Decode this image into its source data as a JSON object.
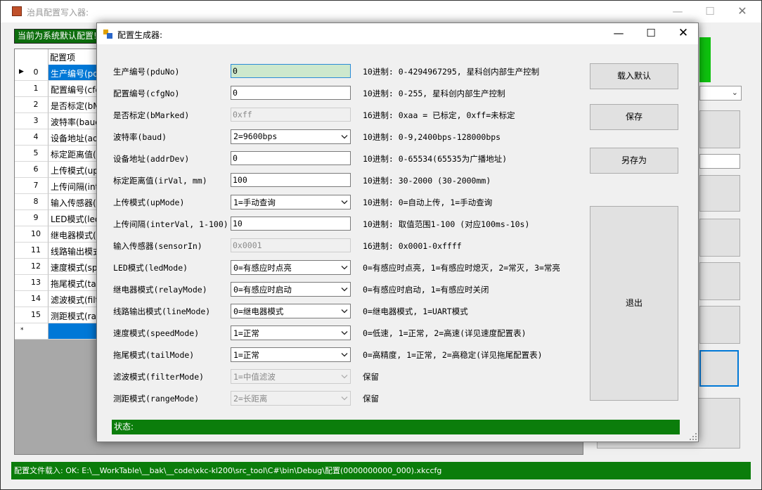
{
  "main_window": {
    "title": "治具配置写入器:",
    "caption": {
      "minimize": "—",
      "maximize": "☐",
      "close": "✕"
    },
    "default_banner": "当前为系统默认配置!",
    "grid": {
      "column_header": "配置项",
      "rows": [
        {
          "index": "0",
          "text": "生产编号(pduNo)",
          "selected": true
        },
        {
          "index": "1",
          "text": "配置编号(cfgNo)"
        },
        {
          "index": "2",
          "text": "是否标定(bMarked)"
        },
        {
          "index": "3",
          "text": "波特率(baud)"
        },
        {
          "index": "4",
          "text": "设备地址(addrDev)"
        },
        {
          "index": "5",
          "text": "标定距离值(irVal, mm)"
        },
        {
          "index": "6",
          "text": "上传模式(upMode)"
        },
        {
          "index": "7",
          "text": "上传间隔(interVal, 1-100)"
        },
        {
          "index": "8",
          "text": "输入传感器(sensorIn)"
        },
        {
          "index": "9",
          "text": "LED模式(ledMode)"
        },
        {
          "index": "10",
          "text": "继电器模式(relayMode)"
        },
        {
          "index": "11",
          "text": "线路输出模式(lineMode)"
        },
        {
          "index": "12",
          "text": "速度模式(speedMode)"
        },
        {
          "index": "13",
          "text": "拖尾模式(tailMode)"
        },
        {
          "index": "14",
          "text": "滤波模式(filterMode)"
        },
        {
          "index": "15",
          "text": "测距模式(rangeMode)"
        }
      ],
      "current_row_marker": "▶",
      "new_row_marker": "*"
    },
    "status_bar": "配置文件载入: OK: E:\\__WorkTable\\__bak\\__code\\xkc-kl200\\src_tool\\C#\\bin\\Debug\\配置(0000000000_000).xkccfg"
  },
  "dialog": {
    "title": "配置生成器:",
    "caption": {
      "minimize": "—",
      "maximize": "☐",
      "close": "✕"
    },
    "fields": [
      {
        "label": "生产编号(pduNo)",
        "control": "input",
        "value": "0",
        "state": "focused",
        "note": "10进制: 0-4294967295, 星科创内部生产控制"
      },
      {
        "label": "配置编号(cfgNo)",
        "control": "input",
        "value": "0",
        "state": "normal",
        "note": "10进制: 0-255, 星科创内部生产控制"
      },
      {
        "label": "是否标定(bMarked)",
        "control": "input",
        "value": "0xff",
        "state": "disabled",
        "note": "16进制: 0xaa = 已标定, 0xff=未标定"
      },
      {
        "label": "波特率(baud)",
        "control": "select",
        "value": "2=9600bps",
        "state": "normal",
        "note": "10进制: 0-9,2400bps-128000bps"
      },
      {
        "label": "设备地址(addrDev)",
        "control": "input",
        "value": "0",
        "state": "normal",
        "note": "10进制: 0-65534(65535为广播地址)"
      },
      {
        "label": "标定距离值(irVal, mm)",
        "control": "input",
        "value": "100",
        "state": "normal",
        "note": "10进制: 30-2000 (30-2000mm)"
      },
      {
        "label": "上传模式(upMode)",
        "control": "select",
        "value": "1=手动查询",
        "state": "normal",
        "note": "10进制: 0=自动上传, 1=手动查询"
      },
      {
        "label": "上传间隔(interVal, 1-100)",
        "control": "input",
        "value": "10",
        "state": "normal",
        "note": "10进制: 取值范围1-100 (对应100ms-10s)"
      },
      {
        "label": "输入传感器(sensorIn)",
        "control": "input",
        "value": "0x0001",
        "state": "disabled",
        "note": "16进制: 0x0001-0xffff"
      },
      {
        "label": "LED模式(ledMode)",
        "control": "select",
        "value": "0=有感应时点亮",
        "state": "normal",
        "note": "0=有感应时点亮, 1=有感应时熄灭, 2=常灭, 3=常亮"
      },
      {
        "label": "继电器模式(relayMode)",
        "control": "select",
        "value": "0=有感应时启动",
        "state": "normal",
        "note": "0=有感应时启动, 1=有感应时关闭"
      },
      {
        "label": "线路输出模式(lineMode)",
        "control": "select",
        "value": "0=继电器模式",
        "state": "normal",
        "note": "0=继电器模式, 1=UART模式"
      },
      {
        "label": "速度模式(speedMode)",
        "control": "select",
        "value": "1=正常",
        "state": "normal",
        "note": "0=低速, 1=正常, 2=高速(详见速度配置表)"
      },
      {
        "label": "拖尾模式(tailMode)",
        "control": "select",
        "value": "1=正常",
        "state": "normal",
        "note": "0=高精度, 1=正常, 2=高稳定(详见拖尾配置表)"
      },
      {
        "label": "滤波模式(filterMode)",
        "control": "select",
        "value": "1=中值滤波",
        "state": "disabled",
        "note": "保留"
      },
      {
        "label": "测距模式(rangeMode)",
        "control": "select",
        "value": "2=长距离",
        "state": "disabled",
        "note": "保留"
      }
    ],
    "buttons": {
      "load_default": "载入默认",
      "save": "保存",
      "save_as": "另存为",
      "exit": "退出"
    },
    "status": "状态:"
  },
  "colors": {
    "status_green": "#0b7d0b",
    "banner_green": "#0c6d0c",
    "selection_blue": "#0078d7",
    "focus_fill": "#cde8cd"
  },
  "icons": [
    "app-icon",
    "dialog-app-icon",
    "chevron-down-icon",
    "minimize-icon",
    "maximize-icon",
    "close-icon",
    "resize-grip-icon"
  ]
}
